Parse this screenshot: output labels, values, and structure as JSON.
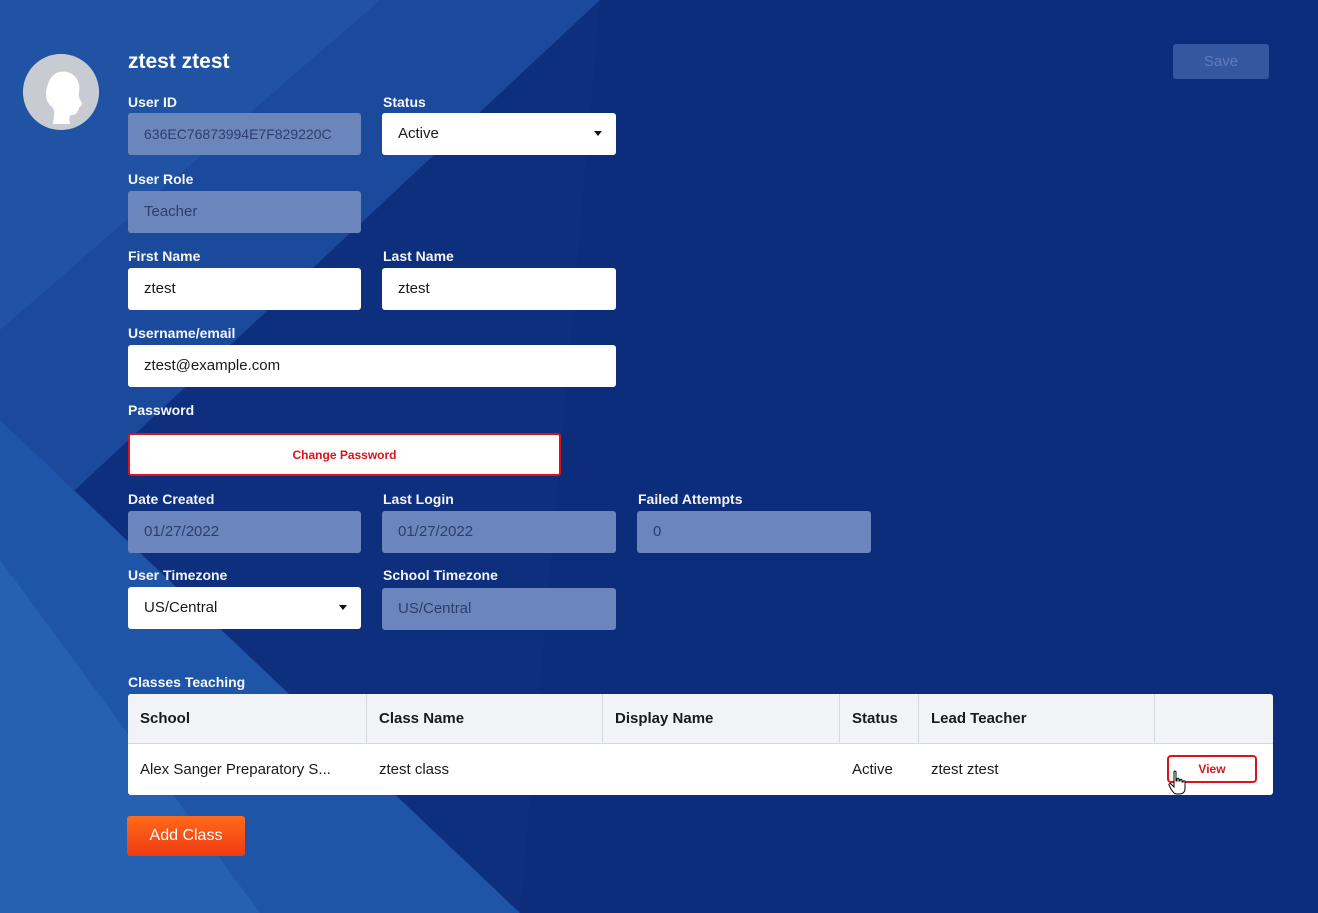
{
  "user": {
    "display_name": "ztest ztest"
  },
  "toolbar": {
    "save_label": "Save"
  },
  "form": {
    "user_id": {
      "label": "User ID",
      "value": "636EC76873994E7F829220C"
    },
    "status": {
      "label": "Status",
      "value": "Active"
    },
    "user_role": {
      "label": "User Role",
      "value": "Teacher"
    },
    "first_name": {
      "label": "First Name",
      "value": "ztest"
    },
    "last_name": {
      "label": "Last Name",
      "value": "ztest"
    },
    "username": {
      "label": "Username/email",
      "value": "ztest@example.com"
    },
    "password": {
      "label": "Password",
      "button": "Change Password"
    },
    "date_created": {
      "label": "Date Created",
      "value": "01/27/2022"
    },
    "last_login": {
      "label": "Last Login",
      "value": "01/27/2022"
    },
    "failed_attempts": {
      "label": "Failed Attempts",
      "value": "0"
    },
    "user_timezone": {
      "label": "User Timezone",
      "value": "US/Central"
    },
    "school_timezone": {
      "label": "School Timezone",
      "value": "US/Central"
    }
  },
  "classes": {
    "title": "Classes Teaching",
    "headers": [
      "School",
      "Class Name",
      "Display Name",
      "Status",
      "Lead Teacher",
      ""
    ],
    "rows": [
      {
        "school": "Alex Sanger Preparatory S...",
        "class_name": "ztest class",
        "display_name": "",
        "status": "Active",
        "lead_teacher": "ztest ztest",
        "action": "View"
      }
    ],
    "add_label": "Add Class"
  },
  "colors": {
    "background": "#0c2f80",
    "accent_red": "#d9141c",
    "accent_orange": "#f04a14",
    "disabled_field": "#6b86bd"
  }
}
